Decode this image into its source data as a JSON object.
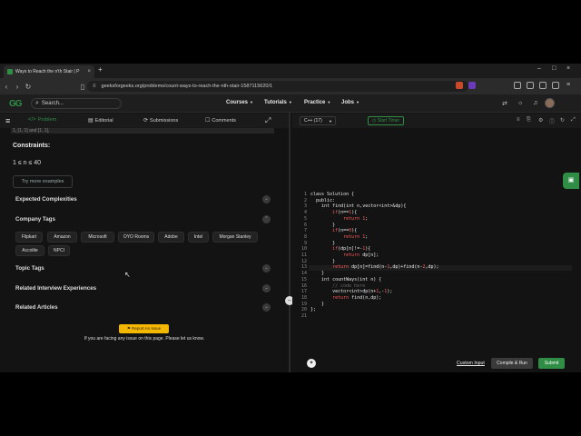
{
  "browser": {
    "tab_title": "Ways to Reach the n'th Stair | P",
    "tab_close": "×",
    "new_tab": "+",
    "url": "geeksforgeeks.org/problems/count-ways-to-reach-the-nth-stair-1587115620/1",
    "window_controls": [
      "–",
      "□",
      "×"
    ]
  },
  "site": {
    "logo": "GG",
    "search_placeholder": "Search...",
    "nav": [
      "Courses",
      "Tutorials",
      "Practice",
      "Jobs"
    ]
  },
  "problem_tabs": [
    {
      "icon": "</>",
      "label": "Problem"
    },
    {
      "icon": "▤",
      "label": "Editorial"
    },
    {
      "icon": "⟳",
      "label": "Submissions"
    },
    {
      "icon": "☐",
      "label": "Comments"
    }
  ],
  "left": {
    "example_fragment": "1, [1, 1] and [1, 1],",
    "constraints_heading": "Constraints:",
    "constraints_value": "1 ≤ n ≤ 40",
    "try_more": "Try more examples",
    "sections": [
      "Expected Complexities",
      "Company Tags",
      "Topic Tags",
      "Related Interview Experiences",
      "Related Articles"
    ],
    "company_tags": [
      "Flipkart",
      "Amazon",
      "Microsoft",
      "OYO Rooms",
      "Adobe",
      "Intel",
      "Morgan Stanley",
      "Accolite",
      "NPCI"
    ],
    "report_button": "⚑ Report An Issue",
    "report_note": "If you are facing any issue on this page. Please let us know."
  },
  "editor": {
    "language": "C++ (17)",
    "timer": "Start Timer",
    "line_numbers": [
      "1",
      "2",
      "3",
      "4",
      "5",
      "6",
      "7",
      "8",
      "9",
      "10",
      "11",
      "12",
      "13",
      "14",
      "15",
      "16",
      "17",
      "18",
      "19",
      "20",
      "21"
    ],
    "custom_input": "Custom Input",
    "compile": "Compile & Run",
    "submit": "Submit"
  },
  "colors": {
    "accent": "#2f8d46",
    "background": "#131313",
    "report": "#f5b800"
  }
}
